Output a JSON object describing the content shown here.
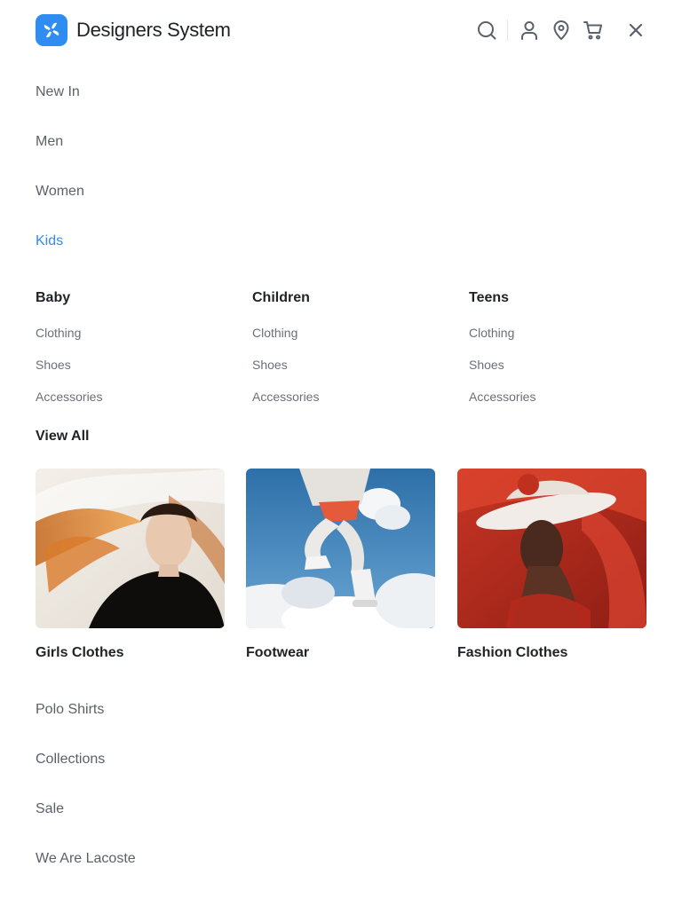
{
  "header": {
    "brand": "Designers System",
    "icons": [
      "search-icon",
      "user-icon",
      "location-pin-icon",
      "cart-icon",
      "close-icon"
    ]
  },
  "nav": {
    "top": [
      {
        "label": "New In"
      },
      {
        "label": "Men"
      },
      {
        "label": "Women"
      },
      {
        "label": "Kids",
        "active": true
      }
    ],
    "bottom": [
      {
        "label": "Polo Shirts"
      },
      {
        "label": "Collections"
      },
      {
        "label": "Sale"
      },
      {
        "label": "We Are Lacoste"
      }
    ]
  },
  "mega_menu": {
    "columns": [
      {
        "title": "Baby",
        "links": [
          "Clothing",
          "Shoes",
          "Accessories"
        ]
      },
      {
        "title": "Children",
        "links": [
          "Clothing",
          "Shoes",
          "Accessories"
        ]
      },
      {
        "title": "Teens",
        "links": [
          "Clothing",
          "Shoes",
          "Accessories"
        ]
      }
    ],
    "view_all": "View All",
    "cards": [
      {
        "label": "Girls Clothes"
      },
      {
        "label": "Footwear"
      },
      {
        "label": "Fashion Clothes"
      }
    ]
  },
  "colors": {
    "accent": "#2f8cf0",
    "text_primary": "#1f2328",
    "text_secondary": "#5b6169"
  }
}
